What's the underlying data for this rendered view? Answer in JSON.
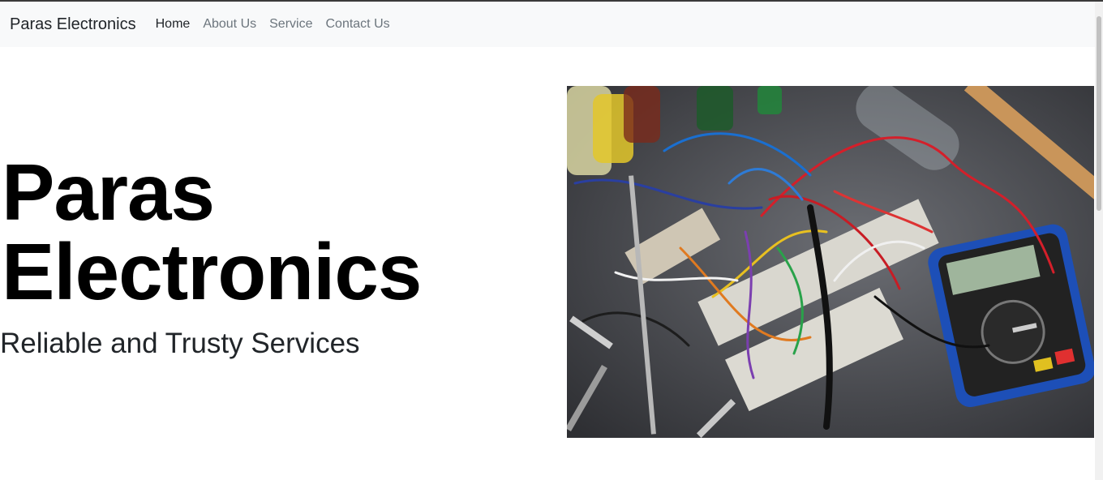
{
  "navbar": {
    "brand": "Paras Electronics",
    "links": [
      {
        "label": "Home",
        "active": true
      },
      {
        "label": "About Us",
        "active": false
      },
      {
        "label": "Service",
        "active": false
      },
      {
        "label": "Contact Us",
        "active": false
      }
    ]
  },
  "hero": {
    "title_line1": "Paras",
    "title_line2": "Electronics",
    "subtitle": "Reliable and Trusty Services",
    "image_subject": "electronics workbench with breadboards, wires and multimeter"
  },
  "colors": {
    "navbar_bg": "#f8f9fa",
    "brand_text": "#212529",
    "nav_inactive": "#6c757d",
    "title_text": "#000000"
  }
}
